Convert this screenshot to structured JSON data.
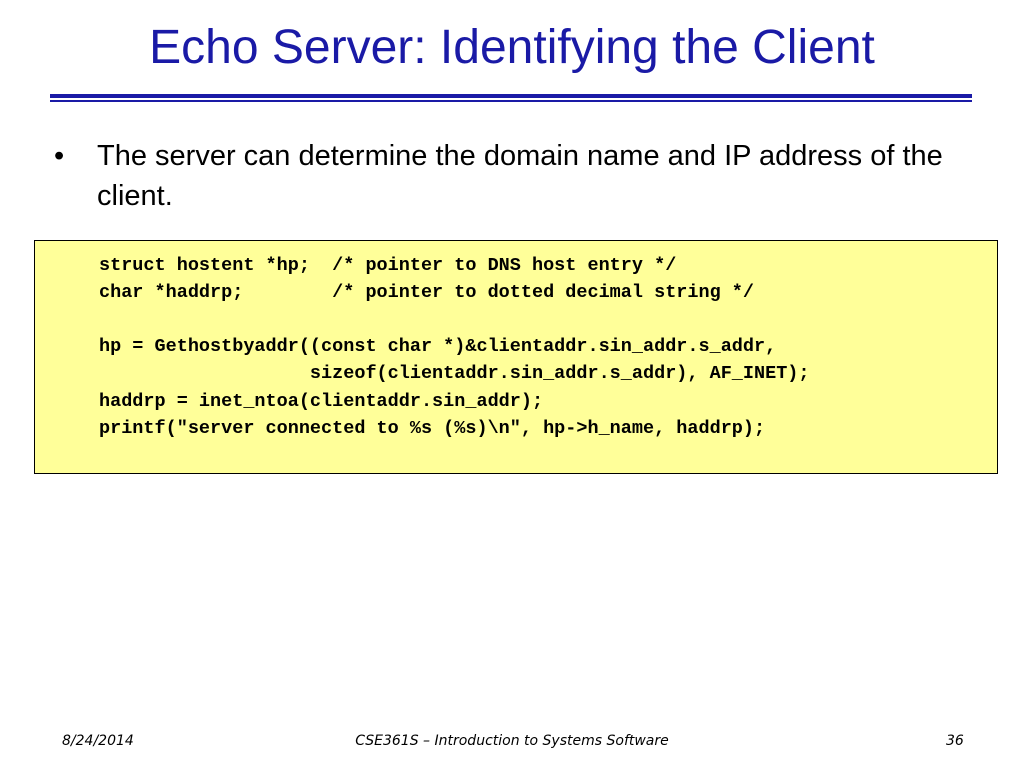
{
  "slide": {
    "title": "Echo Server: Identifying the Client",
    "bullets": [
      {
        "marker": "•",
        "text": "The server can determine the domain name and IP address of the client."
      }
    ]
  },
  "code": {
    "lines": [
      "struct hostent *hp;  /* pointer to DNS host entry */",
      "char *haddrp;        /* pointer to dotted decimal string */",
      "",
      "hp = Gethostbyaddr((const char *)&clientaddr.sin_addr.s_addr,",
      "                   sizeof(clientaddr.sin_addr.s_addr), AF_INET);",
      "haddrp = inet_ntoa(clientaddr.sin_addr);",
      "printf(\"server connected to %s (%s)\\n\", hp->h_name, haddrp);"
    ]
  },
  "footer": {
    "date": "8/24/2014",
    "course": "CSE361S – Introduction to Systems Software",
    "page": "36"
  },
  "colors": {
    "title": "#1a1aa6",
    "code_background": "#ffff99"
  }
}
